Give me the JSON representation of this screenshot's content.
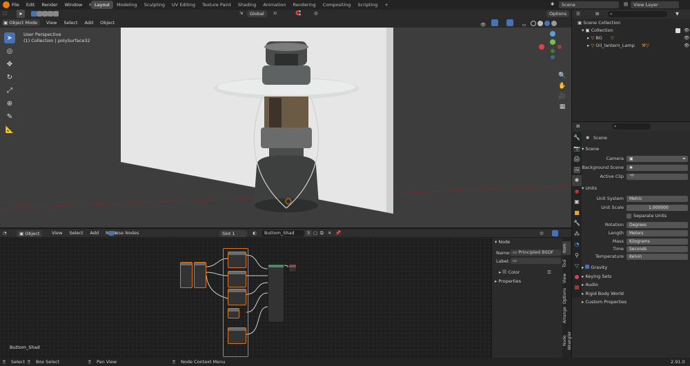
{
  "menubar": {
    "items": [
      "File",
      "Edit",
      "Render",
      "Window",
      "Help"
    ],
    "workspaces": [
      "Layout",
      "Modeling",
      "Sculpting",
      "UV Editing",
      "Texture Paint",
      "Shading",
      "Animation",
      "Rendering",
      "Compositing",
      "Scripting"
    ],
    "active_workspace": "Layout",
    "add_tab": "+",
    "scene": "Scene",
    "view_layer": "View Layer"
  },
  "viewport": {
    "mode": "Object Mode",
    "menu": [
      "View",
      "Select",
      "Add",
      "Object"
    ],
    "orientation": "Global",
    "options": "Options",
    "info_line1": "User Perspective",
    "info_line2": "(1) Collection | polySurface32"
  },
  "outliner": {
    "items": [
      {
        "label": "Scene Collection"
      },
      {
        "label": "Collection"
      },
      {
        "label": "BG"
      },
      {
        "label": "Oil_lantern_Lamp"
      }
    ]
  },
  "properties": {
    "tab_title": "Scene",
    "scene_section": "Scene",
    "camera_label": "Camera",
    "background_scene_label": "Background Scene",
    "active_clip_label": "Active Clip",
    "units_section": "Units",
    "unit_system_label": "Unit System",
    "unit_system": "Metric",
    "unit_scale_label": "Unit Scale",
    "unit_scale": "1.000000",
    "separate_units": "Separate Units",
    "rotation_label": "Rotation",
    "rotation": "Degrees",
    "length_label": "Length",
    "length": "Meters",
    "mass_label": "Mass",
    "mass": "Kilograms",
    "time_label": "Time",
    "time": "Seconds",
    "temperature_label": "Temperature",
    "temperature": "Kelvin",
    "panels": [
      "Gravity",
      "Keying Sets",
      "Audio",
      "Rigid Body World",
      "Custom Properties"
    ]
  },
  "node_editor": {
    "type": "Object",
    "menu": [
      "View",
      "Select",
      "Add",
      "Node"
    ],
    "use_nodes": "Use Nodes",
    "slot": "Slot 1",
    "material": "Buttom_Shad",
    "material_users": "3",
    "label_bottom": "Buttom_Shad",
    "sidebar": {
      "section": "Node",
      "name_label": "Name:",
      "name_value": "Principled BSDF",
      "label_label": "Label:",
      "color": "Color",
      "properties": "Properties"
    },
    "vtabs": [
      "Item",
      "Tool",
      "View",
      "Options",
      "Arrange",
      "Node Wrangler"
    ]
  },
  "statusbar": {
    "select": "Select",
    "box_select": "Box Select",
    "pan_view": "Pan View",
    "context_menu": "Node Context Menu",
    "version": "2.91.0"
  }
}
